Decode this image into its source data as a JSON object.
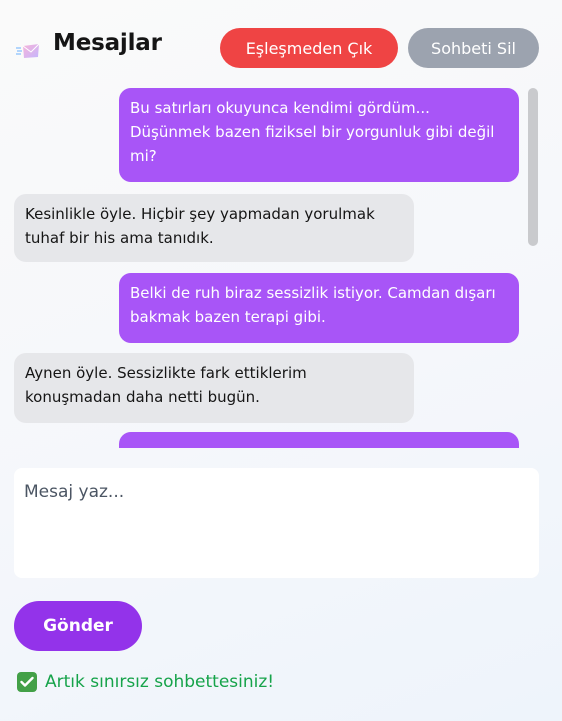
{
  "header": {
    "title": "Mesajlar",
    "leave_label": "Eşleşmeden Çık",
    "delete_label": "Sohbeti Sil"
  },
  "messages": [
    {
      "from": "me",
      "text": "Bu satırları okuyunca kendimi gördüm... Düşünmek bazen fiziksel bir yorgunluk gibi değil mi?"
    },
    {
      "from": "them",
      "text": "Kesinlikle öyle. Hiçbir şey yapmadan yorulmak tuhaf bir his ama tanıdık."
    },
    {
      "from": "me",
      "text": "Belki de ruh biraz sessizlik istiyor. Camdan dışarı bakmak bazen terapi gibi."
    },
    {
      "from": "them",
      "text": "Aynen öyle. Sessizlikte fark ettiklerim konuşmadan daha netti bugün."
    },
    {
      "from": "me",
      "text": ""
    }
  ],
  "compose": {
    "placeholder": "Mesaj yaz...",
    "value": ""
  },
  "send_label": "Gönder",
  "status": {
    "icon": "check-box-icon",
    "text": "Artık sınırsız sohbettesiniz!"
  },
  "colors": {
    "own_bubble": "#a855f7",
    "other_bubble": "#e6e7ea",
    "leave_button": "#ef4444",
    "delete_button": "#9ca3af",
    "send_button": "#9333ea",
    "status_text": "#16a34a"
  }
}
